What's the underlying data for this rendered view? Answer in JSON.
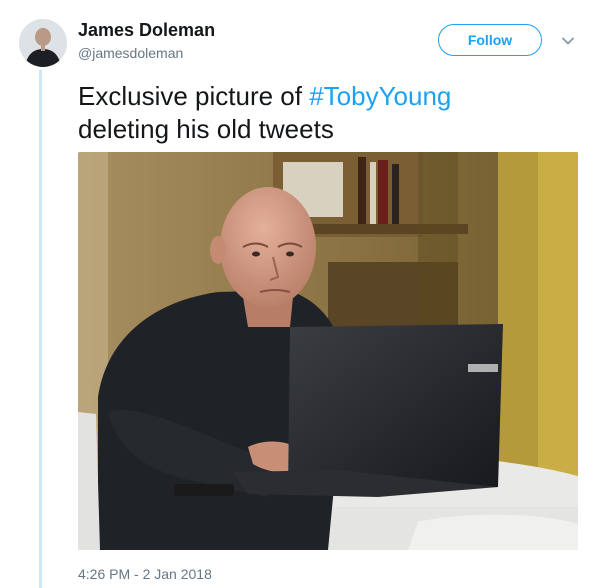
{
  "tweet": {
    "author_name": "James Doleman",
    "author_handle": "@jamesdoleman",
    "follow_label": "Follow",
    "text_before": "Exclusive picture of ",
    "hashtag": "#TobyYoung",
    "text_after": " deleting his old tweets",
    "timestamp": "4:26 PM - 2 Jan 2018"
  },
  "colors": {
    "accent": "#1da1f2",
    "text": "#14171a",
    "muted": "#657786",
    "thread_line": "#cfe6f7"
  },
  "icons": {
    "caret": "chevron-down-icon"
  }
}
